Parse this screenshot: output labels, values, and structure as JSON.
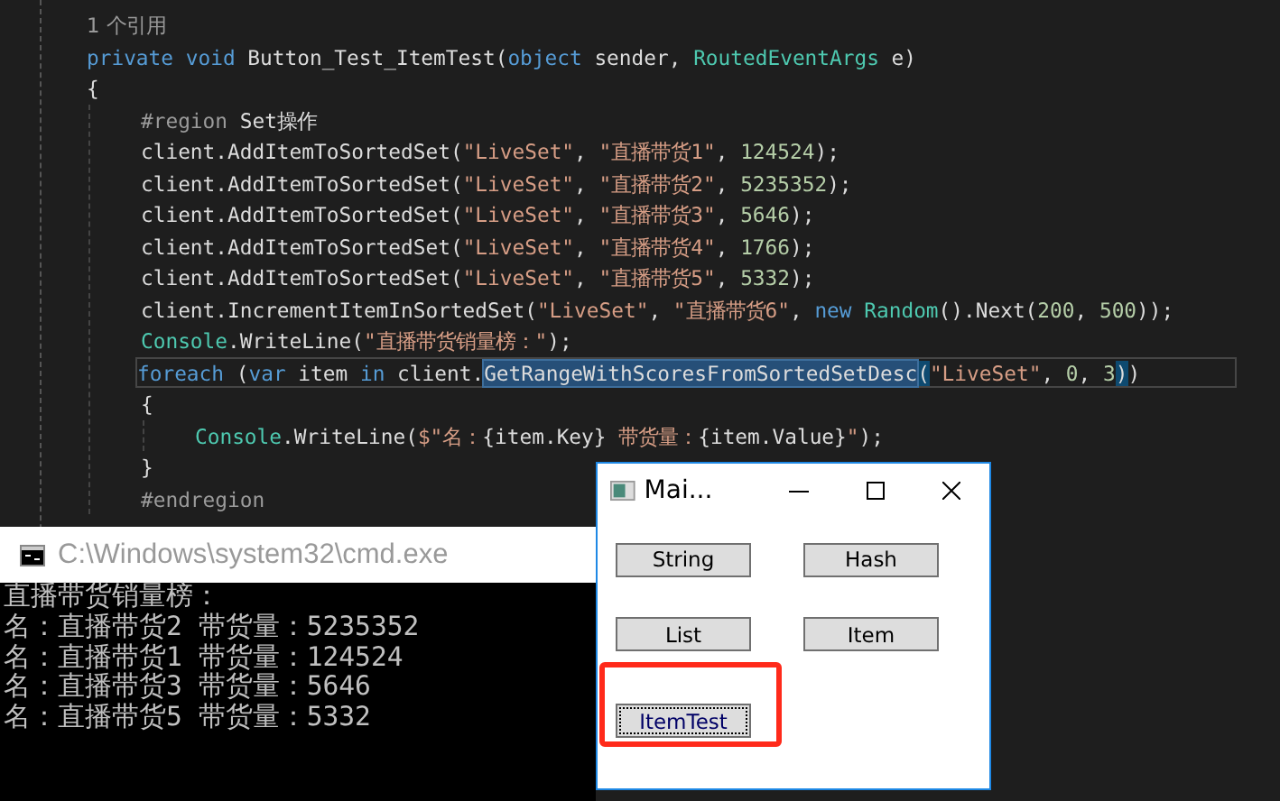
{
  "editor": {
    "lines": [
      {
        "tokens": [
          {
            "t": "1 个引用",
            "kind": "hint"
          }
        ]
      },
      {
        "tokens": [
          {
            "t": "private ",
            "kind": "keyword"
          },
          {
            "t": "void ",
            "kind": "keyword"
          },
          {
            "t": "Button_Test_ItemTest(",
            "kind": "plain"
          },
          {
            "t": "object",
            "kind": "keyword"
          },
          {
            "t": " sender, ",
            "kind": "plain"
          },
          {
            "t": "RoutedEventArgs",
            "kind": "type"
          },
          {
            "t": " e)",
            "kind": "plain"
          }
        ]
      },
      {
        "tokens": [
          {
            "t": "{",
            "kind": "plain"
          }
        ],
        "children": [
          {
            "tokens": [
              {
                "t": "#region",
                "kind": "region"
              },
              {
                "t": " Set操作",
                "kind": "plain"
              }
            ]
          },
          {
            "tokens": [
              {
                "t": "client.AddItemToSortedSet(",
                "kind": "plain"
              },
              {
                "t": "\"LiveSet\"",
                "kind": "string"
              },
              {
                "t": ", ",
                "kind": "plain"
              },
              {
                "t": "\"直播带货1\"",
                "kind": "string"
              },
              {
                "t": ", ",
                "kind": "plain"
              },
              {
                "t": "124524",
                "kind": "number"
              },
              {
                "t": ");",
                "kind": "plain"
              }
            ]
          },
          {
            "tokens": [
              {
                "t": "client.AddItemToSortedSet(",
                "kind": "plain"
              },
              {
                "t": "\"LiveSet\"",
                "kind": "string"
              },
              {
                "t": ", ",
                "kind": "plain"
              },
              {
                "t": "\"直播带货2\"",
                "kind": "string"
              },
              {
                "t": ", ",
                "kind": "plain"
              },
              {
                "t": "5235352",
                "kind": "number"
              },
              {
                "t": ");",
                "kind": "plain"
              }
            ]
          },
          {
            "tokens": [
              {
                "t": "client.AddItemToSortedSet(",
                "kind": "plain"
              },
              {
                "t": "\"LiveSet\"",
                "kind": "string"
              },
              {
                "t": ", ",
                "kind": "plain"
              },
              {
                "t": "\"直播带货3\"",
                "kind": "string"
              },
              {
                "t": ", ",
                "kind": "plain"
              },
              {
                "t": "5646",
                "kind": "number"
              },
              {
                "t": ");",
                "kind": "plain"
              }
            ]
          },
          {
            "tokens": [
              {
                "t": "client.AddItemToSortedSet(",
                "kind": "plain"
              },
              {
                "t": "\"LiveSet\"",
                "kind": "string"
              },
              {
                "t": ", ",
                "kind": "plain"
              },
              {
                "t": "\"直播带货4\"",
                "kind": "string"
              },
              {
                "t": ", ",
                "kind": "plain"
              },
              {
                "t": "1766",
                "kind": "number"
              },
              {
                "t": ");",
                "kind": "plain"
              }
            ]
          },
          {
            "tokens": [
              {
                "t": "client.AddItemToSortedSet(",
                "kind": "plain"
              },
              {
                "t": "\"LiveSet\"",
                "kind": "string"
              },
              {
                "t": ", ",
                "kind": "plain"
              },
              {
                "t": "\"直播带货5\"",
                "kind": "string"
              },
              {
                "t": ", ",
                "kind": "plain"
              },
              {
                "t": "5332",
                "kind": "number"
              },
              {
                "t": ");",
                "kind": "plain"
              }
            ]
          },
          {
            "tokens": [
              {
                "t": "client.IncrementItemInSortedSet(",
                "kind": "plain"
              },
              {
                "t": "\"LiveSet\"",
                "kind": "string"
              },
              {
                "t": ", ",
                "kind": "plain"
              },
              {
                "t": "\"直播带货6\"",
                "kind": "string"
              },
              {
                "t": ", ",
                "kind": "plain"
              },
              {
                "t": "new ",
                "kind": "keyword"
              },
              {
                "t": "Random",
                "kind": "type"
              },
              {
                "t": "().Next(",
                "kind": "plain"
              },
              {
                "t": "200",
                "kind": "number"
              },
              {
                "t": ", ",
                "kind": "plain"
              },
              {
                "t": "500",
                "kind": "number"
              },
              {
                "t": "));",
                "kind": "plain"
              }
            ]
          },
          {
            "tokens": [
              {
                "t": "Console",
                "kind": "type"
              },
              {
                "t": ".WriteLine(",
                "kind": "plain"
              },
              {
                "t": "\"直播带货销量榜：\"",
                "kind": "string"
              },
              {
                "t": ");",
                "kind": "plain"
              }
            ]
          },
          {
            "current": true,
            "tokens": [
              {
                "t": "foreach",
                "kind": "keyword"
              },
              {
                "t": " (",
                "kind": "plain"
              },
              {
                "t": "var",
                "kind": "keyword"
              },
              {
                "t": " item ",
                "kind": "plain"
              },
              {
                "t": "in",
                "kind": "keyword"
              },
              {
                "t": " client.",
                "kind": "plain"
              },
              {
                "t": "GetRangeWithScoresFromSortedSetDesc",
                "kind": "plain",
                "selected": true
              },
              {
                "t": "(",
                "kind": "plain",
                "brace_matched": true
              },
              {
                "t": "\"LiveSet\"",
                "kind": "string"
              },
              {
                "t": ", ",
                "kind": "plain"
              },
              {
                "t": "0",
                "kind": "number"
              },
              {
                "t": ", ",
                "kind": "plain"
              },
              {
                "t": "3",
                "kind": "number"
              },
              {
                "t": ")",
                "kind": "plain",
                "brace_matched": true
              },
              {
                "t": ")",
                "kind": "plain"
              }
            ]
          },
          {
            "tokens": [
              {
                "t": "{",
                "kind": "plain"
              }
            ],
            "children": [
              {
                "tokens": [
                  {
                    "t": "Console",
                    "kind": "type"
                  },
                  {
                    "t": ".WriteLine(",
                    "kind": "plain"
                  },
                  {
                    "t": "$\"名：",
                    "kind": "string"
                  },
                  {
                    "t": "{item.Key}",
                    "kind": "plain"
                  },
                  {
                    "t": " 带货量：",
                    "kind": "string"
                  },
                  {
                    "t": "{item.Value}",
                    "kind": "plain"
                  },
                  {
                    "t": "\"",
                    "kind": "string"
                  },
                  {
                    "t": ");",
                    "kind": "plain"
                  }
                ]
              }
            ]
          },
          {
            "tokens": [
              {
                "t": "}",
                "kind": "plain"
              }
            ]
          },
          {
            "tokens": [
              {
                "t": "#endregion",
                "kind": "region"
              }
            ]
          }
        ]
      }
    ]
  },
  "console": {
    "title": "C:\\Windows\\system32\\cmd.exe",
    "lines": [
      "直播带货销量榜：",
      "名：直播带货2 带货量：5235352",
      "名：直播带货1 带货量：124524",
      "名：直播带货3 带货量：5646",
      "名：直播带货5 带货量：5332"
    ]
  },
  "app_window": {
    "title": "Mai...",
    "buttons": [
      {
        "label": "String",
        "focused": false
      },
      {
        "label": "Hash",
        "focused": false
      },
      {
        "label": "List",
        "focused": false
      },
      {
        "label": "Item",
        "focused": false
      },
      {
        "label": "ItemTest",
        "focused": true,
        "annotated": true
      }
    ]
  }
}
